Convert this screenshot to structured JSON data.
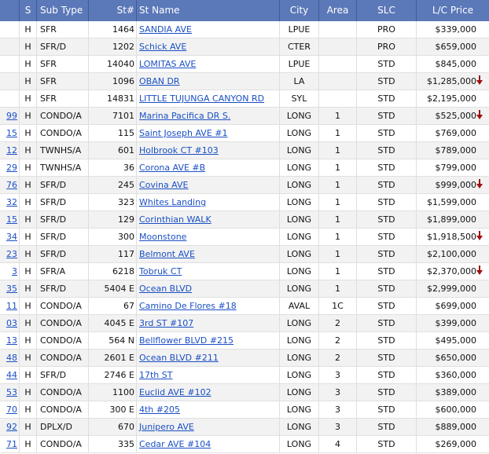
{
  "header": {
    "s": "S",
    "sub_type": "Sub Type",
    "st_no": "St#",
    "st_name": "St Name",
    "city": "City",
    "area": "Area",
    "slc": "SLC",
    "lc_price": "L/C Price"
  },
  "rows": [
    {
      "ref": "",
      "s": "H",
      "sub_type": "SFR",
      "st_no": "1464",
      "st_name": "SANDIA AVE",
      "city": "LPUE",
      "area": "",
      "slc": "PRO",
      "price": "$339,000",
      "drop": false
    },
    {
      "ref": "",
      "s": "H",
      "sub_type": "SFR/D",
      "st_no": "1202",
      "st_name": "Schick AVE",
      "city": "CTER",
      "area": "",
      "slc": "PRO",
      "price": "$659,000",
      "drop": false
    },
    {
      "ref": "",
      "s": "H",
      "sub_type": "SFR",
      "st_no": "14040",
      "st_name": "LOMITAS AVE",
      "city": "LPUE",
      "area": "",
      "slc": "STD",
      "price": "$845,000",
      "drop": false
    },
    {
      "ref": "",
      "s": "H",
      "sub_type": "SFR",
      "st_no": "1096",
      "st_name": "OBAN DR",
      "city": "LA",
      "area": "",
      "slc": "STD",
      "price": "$1,285,000",
      "drop": true
    },
    {
      "ref": "",
      "s": "H",
      "sub_type": "SFR",
      "st_no": "14831",
      "st_name": "LITTLE TUJUNGA CANYON RD",
      "city": "SYL",
      "area": "",
      "slc": "STD",
      "price": "$2,195,000",
      "drop": false
    },
    {
      "ref": "99",
      "s": "H",
      "sub_type": "CONDO/A",
      "st_no": "7101",
      "st_name": "Marina Pacifica DR S.",
      "city": "LONG",
      "area": "1",
      "slc": "STD",
      "price": "$525,000",
      "drop": true
    },
    {
      "ref": "15",
      "s": "H",
      "sub_type": "CONDO/A",
      "st_no": "115",
      "st_name": "Saint Joseph AVE #1",
      "city": "LONG",
      "area": "1",
      "slc": "STD",
      "price": "$769,000",
      "drop": false
    },
    {
      "ref": "12",
      "s": "H",
      "sub_type": "TWNHS/A",
      "st_no": "601",
      "st_name": "Holbrook CT #103",
      "city": "LONG",
      "area": "1",
      "slc": "STD",
      "price": "$789,000",
      "drop": false
    },
    {
      "ref": "29",
      "s": "H",
      "sub_type": "TWNHS/A",
      "st_no": "36",
      "st_name": "Corona AVE #B",
      "city": "LONG",
      "area": "1",
      "slc": "STD",
      "price": "$799,000",
      "drop": false
    },
    {
      "ref": "76",
      "s": "H",
      "sub_type": "SFR/D",
      "st_no": "245",
      "st_name": "Covina AVE",
      "city": "LONG",
      "area": "1",
      "slc": "STD",
      "price": "$999,000",
      "drop": true
    },
    {
      "ref": "32",
      "s": "H",
      "sub_type": "SFR/D",
      "st_no": "323",
      "st_name": "Whites Landing",
      "city": "LONG",
      "area": "1",
      "slc": "STD",
      "price": "$1,599,000",
      "drop": false
    },
    {
      "ref": "15",
      "s": "H",
      "sub_type": "SFR/D",
      "st_no": "129",
      "st_name": "Corinthian WALK",
      "city": "LONG",
      "area": "1",
      "slc": "STD",
      "price": "$1,899,000",
      "drop": false
    },
    {
      "ref": "34",
      "s": "H",
      "sub_type": "SFR/D",
      "st_no": "300",
      "st_name": "Moonstone",
      "city": "LONG",
      "area": "1",
      "slc": "STD",
      "price": "$1,918,500",
      "drop": true
    },
    {
      "ref": "23",
      "s": "H",
      "sub_type": "SFR/D",
      "st_no": "117",
      "st_name": "Belmont AVE",
      "city": "LONG",
      "area": "1",
      "slc": "STD",
      "price": "$2,100,000",
      "drop": false
    },
    {
      "ref": "3",
      "s": "H",
      "sub_type": "SFR/A",
      "st_no": "6218",
      "st_name": "Tobruk CT",
      "city": "LONG",
      "area": "1",
      "slc": "STD",
      "price": "$2,370,000",
      "drop": true
    },
    {
      "ref": "35",
      "s": "H",
      "sub_type": "SFR/D",
      "st_no": "5404 E",
      "st_name": "Ocean BLVD",
      "city": "LONG",
      "area": "1",
      "slc": "STD",
      "price": "$2,999,000",
      "drop": false
    },
    {
      "ref": "11",
      "s": "H",
      "sub_type": "CONDO/A",
      "st_no": "67",
      "st_name": "Camino De Flores #18",
      "city": "AVAL",
      "area": "1C",
      "slc": "STD",
      "price": "$699,000",
      "drop": false
    },
    {
      "ref": "03",
      "s": "H",
      "sub_type": "CONDO/A",
      "st_no": "4045 E",
      "st_name": "3rd ST #107",
      "city": "LONG",
      "area": "2",
      "slc": "STD",
      "price": "$399,000",
      "drop": false
    },
    {
      "ref": "13",
      "s": "H",
      "sub_type": "CONDO/A",
      "st_no": "564 N",
      "st_name": "Bellflower BLVD #215",
      "city": "LONG",
      "area": "2",
      "slc": "STD",
      "price": "$495,000",
      "drop": false
    },
    {
      "ref": "48",
      "s": "H",
      "sub_type": "CONDO/A",
      "st_no": "2601 E",
      "st_name": "Ocean BLVD #211",
      "city": "LONG",
      "area": "2",
      "slc": "STD",
      "price": "$650,000",
      "drop": false
    },
    {
      "ref": "44",
      "s": "H",
      "sub_type": "SFR/D",
      "st_no": "2746 E",
      "st_name": "17th ST",
      "city": "LONG",
      "area": "3",
      "slc": "STD",
      "price": "$360,000",
      "drop": false
    },
    {
      "ref": "53",
      "s": "H",
      "sub_type": "CONDO/A",
      "st_no": "1100",
      "st_name": "Euclid AVE #102",
      "city": "LONG",
      "area": "3",
      "slc": "STD",
      "price": "$389,000",
      "drop": false
    },
    {
      "ref": "70",
      "s": "H",
      "sub_type": "CONDO/A",
      "st_no": "300 E",
      "st_name": "4th #205",
      "city": "LONG",
      "area": "3",
      "slc": "STD",
      "price": "$600,000",
      "drop": false
    },
    {
      "ref": "92",
      "s": "H",
      "sub_type": "DPLX/D",
      "st_no": "670",
      "st_name": "Junipero AVE",
      "city": "LONG",
      "area": "3",
      "slc": "STD",
      "price": "$889,000",
      "drop": false
    },
    {
      "ref": "71",
      "s": "H",
      "sub_type": "CONDO/A",
      "st_no": "335",
      "st_name": "Cedar AVE #104",
      "city": "LONG",
      "area": "4",
      "slc": "STD",
      "price": "$269,000",
      "drop": false
    }
  ]
}
